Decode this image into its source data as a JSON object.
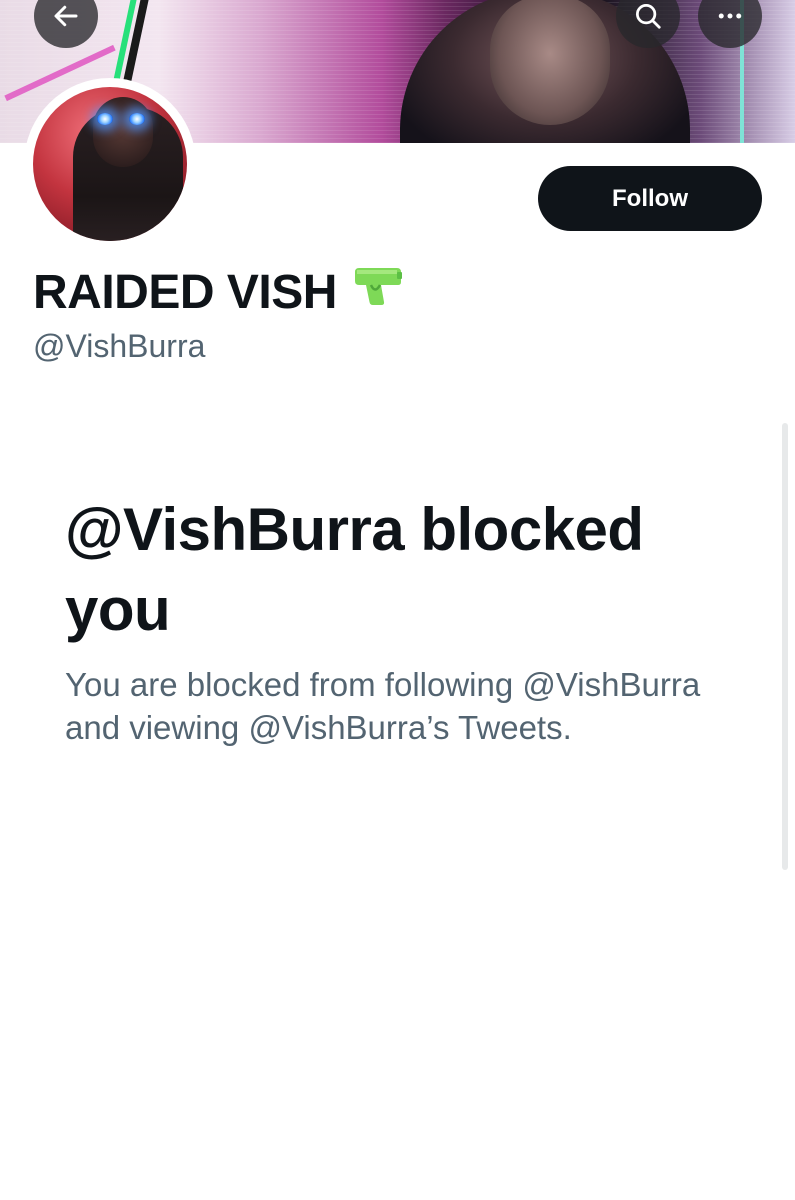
{
  "header": {
    "back_icon": "arrow-left-icon",
    "search_icon": "search-icon",
    "more_icon": "more-horizontal-icon"
  },
  "profile": {
    "display_name": "RAIDED VISH",
    "name_emoji": "🔫",
    "handle": "@VishBurra",
    "follow_label": "Follow"
  },
  "blocked": {
    "title": "@VishBurra blocked you",
    "description": "You are blocked from following @VishBurra and viewing @VishBurra’s Tweets."
  },
  "colors": {
    "primary_text": "#0f1419",
    "secondary_text": "#536471",
    "follow_button_bg": "#0f1419",
    "follow_button_text": "#ffffff"
  }
}
